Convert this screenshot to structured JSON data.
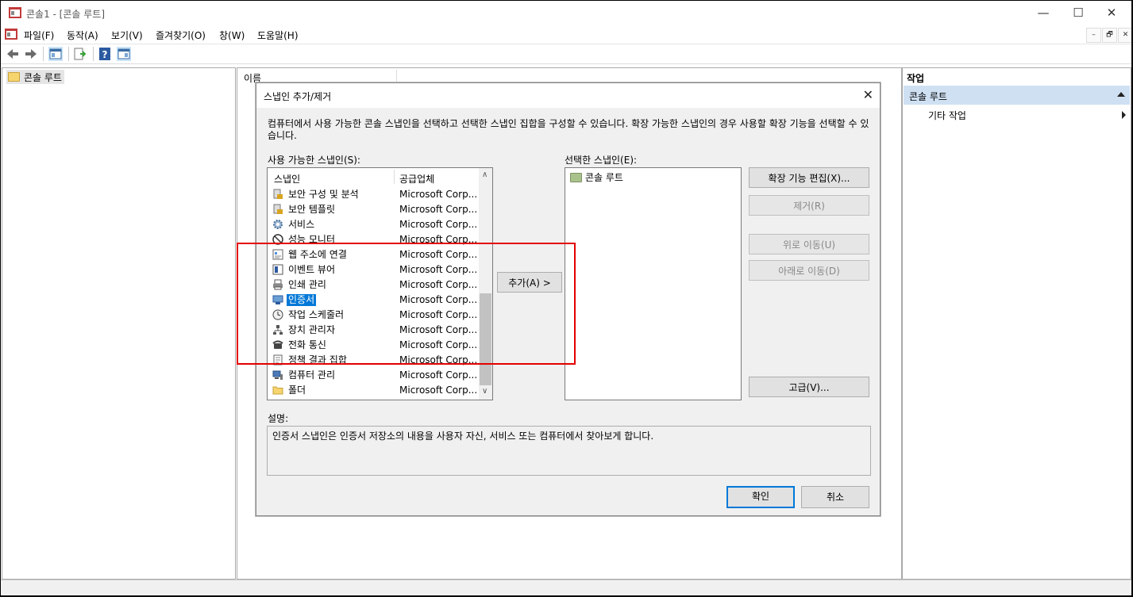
{
  "window": {
    "title": "콘솔1 - [콘솔 루트]",
    "controls": {
      "minimize": "—",
      "maximize": "☐",
      "close": "✕"
    }
  },
  "menu": {
    "items": [
      "파일(F)",
      "동작(A)",
      "보기(V)",
      "즐겨찾기(O)",
      "창(W)",
      "도움말(H)"
    ],
    "mdi_controls": {
      "minimize": "–",
      "restore": "🗗",
      "close": "✕"
    }
  },
  "tree": {
    "root": "콘솔 루트"
  },
  "main": {
    "column_header": "이름"
  },
  "actions": {
    "title": "작업",
    "section": "콘솔 루트",
    "item": "기타 작업"
  },
  "dialog": {
    "title": "스냅인 추가/제거",
    "description": "컴퓨터에서 사용 가능한 콘솔 스냅인을 선택하고 선택한 스냅인 집합을 구성할 수 있습니다. 확장 가능한 스냅인의 경우 사용할 확장 기능을 선택할 수 있습니다.",
    "available_label": "사용 가능한 스냅인(S):",
    "selected_label": "선택한 스냅인(E):",
    "list_headers": {
      "name": "스냅인",
      "vendor": "공급업체"
    },
    "snapins": [
      {
        "name": "보안 구성 및 분석",
        "vendor": "Microsoft Corp...",
        "icon": "security-lock-icon"
      },
      {
        "name": "보안 템플릿",
        "vendor": "Microsoft Corp...",
        "icon": "security-lock-icon"
      },
      {
        "name": "서비스",
        "vendor": "Microsoft Corp...",
        "icon": "gear-icon"
      },
      {
        "name": "성능 모니터",
        "vendor": "Microsoft Corp...",
        "icon": "no-entry-icon"
      },
      {
        "name": "웹 주소에 연결",
        "vendor": "Microsoft Corp...",
        "icon": "web-page-icon"
      },
      {
        "name": "이벤트 뷰어",
        "vendor": "Microsoft Corp...",
        "icon": "event-log-icon"
      },
      {
        "name": "인쇄 관리",
        "vendor": "Microsoft Corp...",
        "icon": "printer-icon"
      },
      {
        "name": "인증서",
        "vendor": "Microsoft Corp...",
        "icon": "certificate-icon",
        "selected": true
      },
      {
        "name": "작업 스케줄러",
        "vendor": "Microsoft Corp...",
        "icon": "clock-icon"
      },
      {
        "name": "장치 관리자",
        "vendor": "Microsoft Corp...",
        "icon": "device-tree-icon"
      },
      {
        "name": "전화 통신",
        "vendor": "Microsoft Corp...",
        "icon": "telephone-icon"
      },
      {
        "name": "정책 결과 집합",
        "vendor": "Microsoft Corp...",
        "icon": "policy-icon"
      },
      {
        "name": "컴퓨터 관리",
        "vendor": "Microsoft Corp...",
        "icon": "computer-management-icon"
      },
      {
        "name": "폴더",
        "vendor": "Microsoft Corp...",
        "icon": "folder-icon"
      }
    ],
    "selected_snapins": [
      "콘솔 루트"
    ],
    "buttons": {
      "add": "추가(A) >",
      "edit_extensions": "확장 기능 편집(X)...",
      "remove": "제거(R)",
      "move_up": "위로 이동(U)",
      "move_down": "아래로 이동(D)",
      "advanced": "고급(V)...",
      "ok": "확인",
      "cancel": "취소"
    },
    "explanation_label": "설명:",
    "explanation_text": "인증서 스냅인은 인증서 저장소의 내용을 사용자 자신, 서비스 또는 컴퓨터에서 찾아보게 합니다."
  },
  "colors": {
    "highlight_box": "#e30000",
    "selection": "#0078d7",
    "action_section": "#cfe0f3"
  }
}
